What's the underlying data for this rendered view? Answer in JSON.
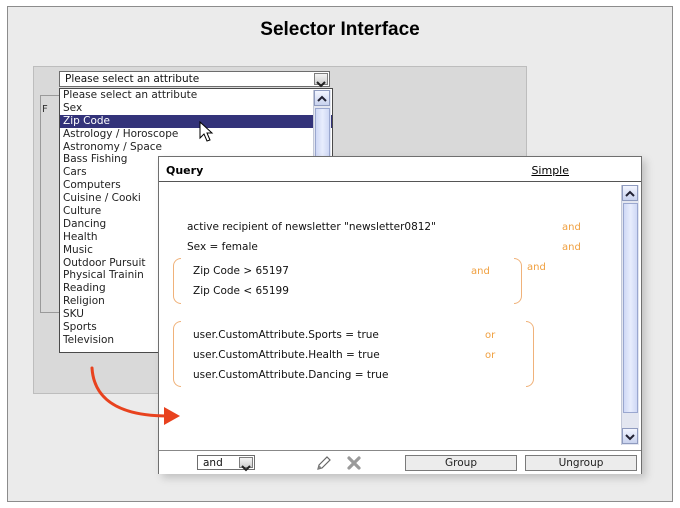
{
  "page_title": "Selector Interface",
  "selector": {
    "combo_value": "Please select an attribute",
    "ghost_label": "F",
    "options": [
      "Please select an attribute",
      "Sex",
      "Zip Code",
      "Astrology / Horoscope",
      "Astronomy / Space",
      "Bass Fishing",
      "Cars",
      "Computers",
      "Cuisine / Cooki",
      "Culture",
      "Dancing",
      "Health",
      "Music",
      "Outdoor Pursuit",
      "Physical Trainin",
      "Reading",
      "Religion",
      "SKU",
      "Sports",
      "Television"
    ],
    "selected_index": 2
  },
  "query": {
    "title": "Query",
    "simple_link": "Simple",
    "lines": {
      "l1": "active recipient of newsletter \"newsletter0812\"",
      "l2": "Sex = female",
      "l3": "Zip Code > 65197",
      "l4": "Zip Code < 65199",
      "l5": "user.CustomAttribute.Sports = true",
      "l6": "user.CustomAttribute.Health = true",
      "l7": "user.CustomAttribute.Dancing = true"
    },
    "ops": {
      "o1": "and",
      "o2": "and",
      "o3": "and",
      "o4": "and",
      "o5": "or",
      "o6": "or"
    },
    "footer": {
      "operator_value": "and",
      "group_label": "Group",
      "ungroup_label": "Ungroup"
    }
  },
  "icons": {
    "pencil": "pencil-icon",
    "delete": "delete-x-icon",
    "cursor": "mouse-cursor-icon",
    "arrow": "curved-arrow-icon"
  },
  "colors": {
    "selected_option_bg": "#33337a",
    "operator_text": "#f0a040",
    "brace": "#f0b27a",
    "arrow": "#e8421e"
  }
}
